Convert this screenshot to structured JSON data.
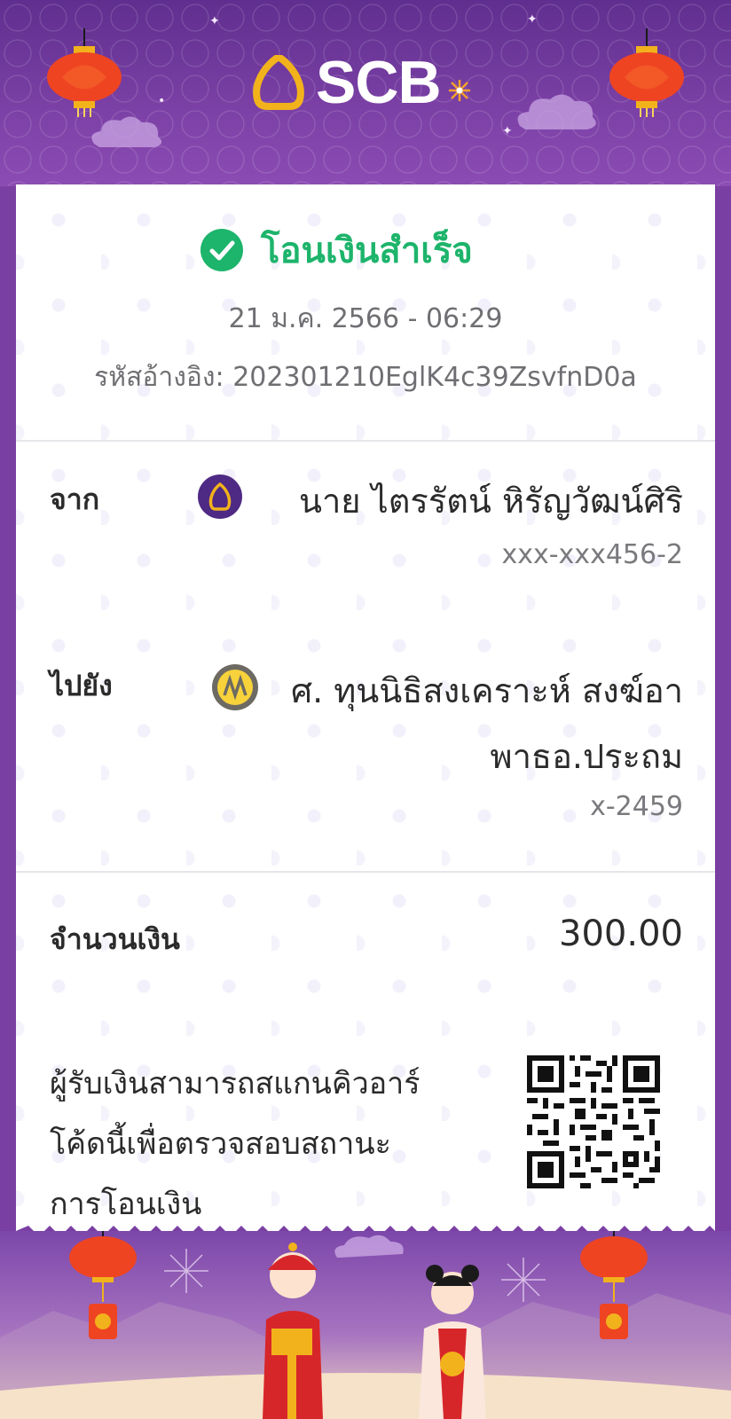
{
  "brand": {
    "name": "SCB"
  },
  "transfer": {
    "status": "โอนเงินสำเร็จ",
    "datetime": "21 ม.ค. 2566 - 06:29",
    "reference": "รหัสอ้างอิง: 202301210EglK4c39ZsvfnD0a"
  },
  "sender": {
    "label": "จาก",
    "name": "นาย ไตรรัตน์ หิรัญวัฒน์ศิริ",
    "account": "xxx-xxx456-2",
    "bank_icon": "scb-bank-icon"
  },
  "recipient": {
    "label": "ไปยัง",
    "name_line1": "ศ. ทุนนิธิสงเคราะห์ สงฆ์อา",
    "name_line2": "พาธอ.ประถม",
    "account": "x-2459",
    "bank_icon": "krungsri-bank-icon"
  },
  "amount": {
    "label": "จำนวนเงิน",
    "value": "300.00"
  },
  "qr": {
    "line1": "ผู้รับเงินสามารถสแกนคิวอาร์",
    "line2": "โค้ดนี้เพื่อตรวจสอบสถานะ",
    "line3": "การโอนเงิน"
  },
  "colors": {
    "purple": "#7a3fa3",
    "success": "#1db46b",
    "gold": "#f2b21c"
  }
}
